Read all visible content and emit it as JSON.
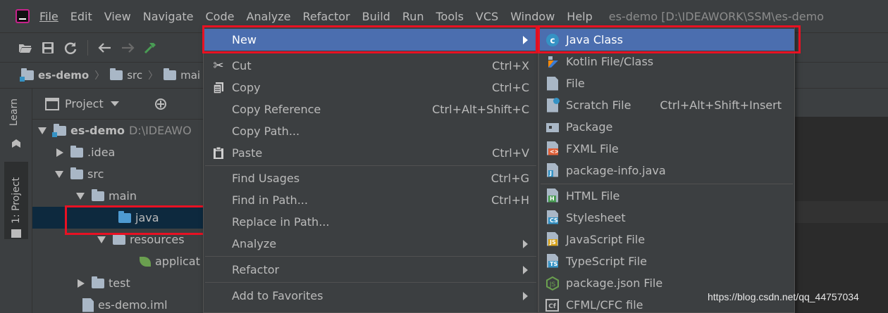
{
  "menubar": {
    "items": [
      "File",
      "Edit",
      "View",
      "Navigate",
      "Code",
      "Analyze",
      "Refactor",
      "Build",
      "Run",
      "Tools",
      "VCS",
      "Window",
      "Help"
    ],
    "window_title": "es-demo [D:\\IDEAWORK\\SSM\\es-demo"
  },
  "toolbar": {
    "icons": [
      "open-folder-icon",
      "save-icon",
      "sync-icon",
      "back-arrow-icon",
      "forward-arrow-icon",
      "build-hammer-icon"
    ]
  },
  "breadcrumb": [
    "es-demo",
    "src",
    "mai"
  ],
  "side_strip": {
    "learn": "Learn",
    "project": "1: Project"
  },
  "project_panel": {
    "title": "Project",
    "tree": [
      {
        "label": "es-demo",
        "path": "D:\\IDEAWO"
      },
      {
        "label": ".idea"
      },
      {
        "label": "src"
      },
      {
        "label": "main"
      },
      {
        "label": "java"
      },
      {
        "label": "resources"
      },
      {
        "label": "applicat"
      },
      {
        "label": "test"
      },
      {
        "label": "es-demo.iml"
      }
    ]
  },
  "context_menu": {
    "items": [
      {
        "label": "New",
        "shortcut": "",
        "submenu": true,
        "icon": ""
      },
      {
        "label": "Cut",
        "shortcut": "Ctrl+X",
        "icon": "scissors-icon"
      },
      {
        "label": "Copy",
        "shortcut": "Ctrl+C",
        "icon": "copy-icon"
      },
      {
        "label": "Copy Reference",
        "shortcut": "Ctrl+Alt+Shift+C"
      },
      {
        "label": "Copy Path...",
        "shortcut": ""
      },
      {
        "label": "Paste",
        "shortcut": "Ctrl+V",
        "icon": "paste-icon"
      },
      {
        "label": "Find Usages",
        "shortcut": "Ctrl+G"
      },
      {
        "label": "Find in Path...",
        "shortcut": "Ctrl+H"
      },
      {
        "label": "Replace in Path...",
        "shortcut": ""
      },
      {
        "label": "Analyze",
        "shortcut": "",
        "submenu": true
      },
      {
        "label": "Refactor",
        "shortcut": "",
        "submenu": true
      },
      {
        "label": "Add to Favorites",
        "shortcut": "",
        "submenu": true
      }
    ]
  },
  "sub_menu": {
    "items": [
      {
        "label": "Java Class",
        "icon": "java-class-icon"
      },
      {
        "label": "Kotlin File/Class",
        "icon": "kotlin-icon"
      },
      {
        "label": "File",
        "icon": "file-icon"
      },
      {
        "label": "Scratch File",
        "shortcut": "Ctrl+Alt+Shift+Insert",
        "icon": "scratch-file-icon"
      },
      {
        "label": "Package",
        "icon": "package-icon"
      },
      {
        "label": "FXML File",
        "icon": "fxml-file-icon"
      },
      {
        "label": "package-info.java",
        "icon": "package-info-icon"
      },
      {
        "label": "HTML File",
        "icon": "html-file-icon"
      },
      {
        "label": "Stylesheet",
        "icon": "css-file-icon"
      },
      {
        "label": "JavaScript File",
        "icon": "js-file-icon"
      },
      {
        "label": "TypeScript File",
        "icon": "ts-file-icon"
      },
      {
        "label": "package.json File",
        "icon": "nodejs-icon"
      },
      {
        "label": "CFML/CFC file",
        "icon": "cfml-icon"
      }
    ]
  },
  "watermark": "https://blog.csdn.net/qq_44757034",
  "colors": {
    "selection": "#4b6eaf",
    "highlight_box": "#e81123",
    "background": "#3c3f41"
  }
}
